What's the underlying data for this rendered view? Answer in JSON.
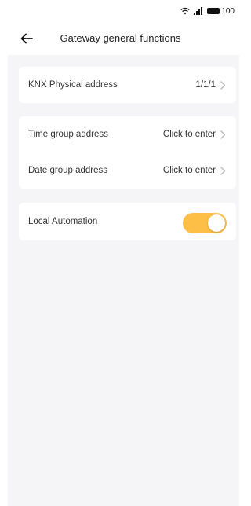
{
  "status_bar": {
    "battery_level": "100",
    "icons": [
      "wifi-icon",
      "signal-icon",
      "battery-icon"
    ]
  },
  "header": {
    "title": "Gateway general functions",
    "back_icon": "arrow-left-icon"
  },
  "physical_section": {
    "label": "KNX Physical address",
    "value": "1/1/1"
  },
  "group_section": {
    "time_label": "Time group address",
    "time_value": "Click to enter",
    "date_label": "Date group address",
    "date_value": "Click to enter"
  },
  "automation_section": {
    "label": "Local Automation",
    "enabled": true,
    "accent_color": "#fdbf45"
  },
  "colors": {
    "background": "#f5f5f7",
    "card": "#ffffff",
    "chevron": "#b8b8b8"
  }
}
